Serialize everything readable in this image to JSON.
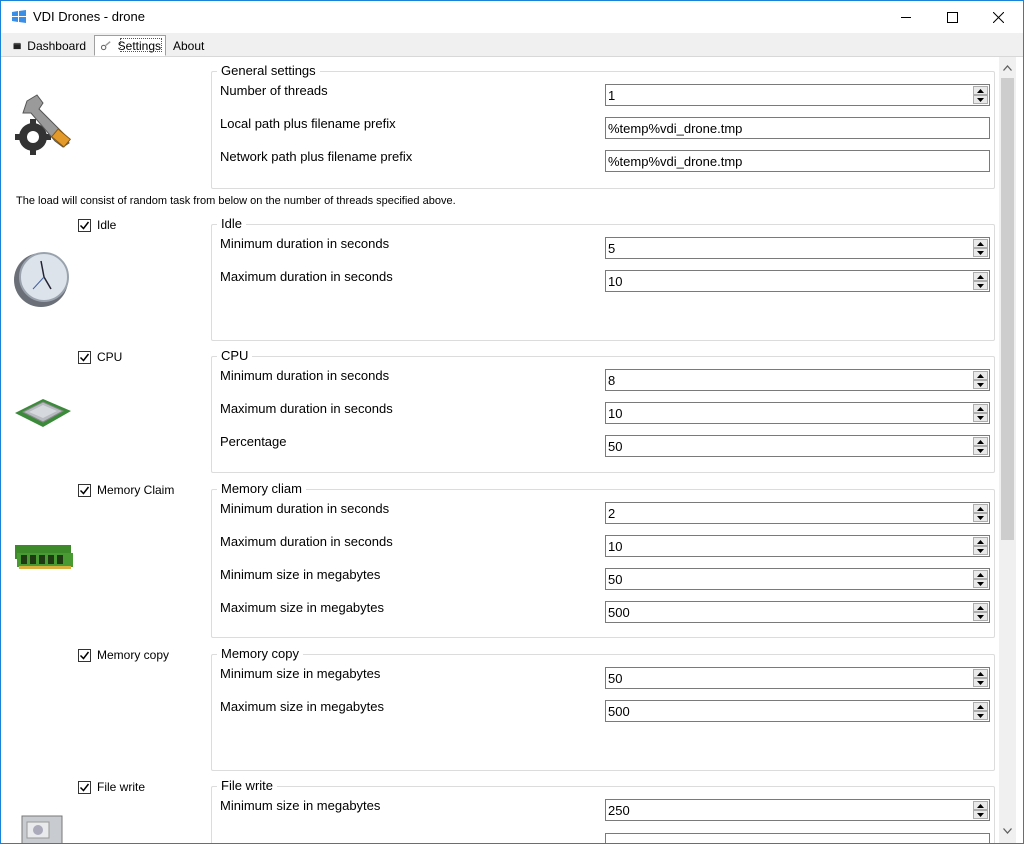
{
  "window": {
    "title": "VDI Drones - drone"
  },
  "tabs": [
    {
      "label": "Dashboard",
      "icon": "dashboard-icon"
    },
    {
      "label": "Settings",
      "icon": "wrench-icon",
      "selected": true
    },
    {
      "label": "About"
    }
  ],
  "general": {
    "title": "General settings",
    "threads": {
      "label": "Number of threads",
      "value": "1"
    },
    "local_path": {
      "label": "Local path plus filename prefix",
      "value": "%temp%vdi_drone.tmp"
    },
    "network_path": {
      "label": "Network path plus filename prefix",
      "value": "%temp%vdi_drone.tmp"
    }
  },
  "hint": "The load will consist of random task from below on the number of threads specified above.",
  "idle": {
    "check_label": "Idle",
    "title": "Idle",
    "min": {
      "label": "Minimum duration in seconds",
      "value": "5"
    },
    "max": {
      "label": "Maximum duration in seconds",
      "value": "10"
    }
  },
  "cpu": {
    "check_label": "CPU",
    "title": "CPU",
    "min": {
      "label": "Minimum duration in seconds",
      "value": "8"
    },
    "max": {
      "label": "Maximum duration in seconds",
      "value": "10"
    },
    "pct": {
      "label": "Percentage",
      "value": "50"
    }
  },
  "memclaim": {
    "check_label": "Memory Claim",
    "title": "Memory cliam",
    "min": {
      "label": "Minimum duration in seconds",
      "value": "2"
    },
    "max": {
      "label": "Maximum duration in seconds",
      "value": "10"
    },
    "minsize": {
      "label": "Minimum size in megabytes",
      "value": "50"
    },
    "maxsize": {
      "label": "Maximum size in megabytes",
      "value": "500"
    }
  },
  "memcopy": {
    "check_label": "Memory copy",
    "title": "Memory copy",
    "minsize": {
      "label": "Minimum size in megabytes",
      "value": "50"
    },
    "maxsize": {
      "label": "Maximum size in megabytes",
      "value": "500"
    }
  },
  "filewrite": {
    "check_label": "File write",
    "title": "File write",
    "minsize": {
      "label": "Minimum size in megabytes",
      "value": "250"
    }
  },
  "colors": {
    "accent": "#1883d7",
    "check": "#000000"
  }
}
